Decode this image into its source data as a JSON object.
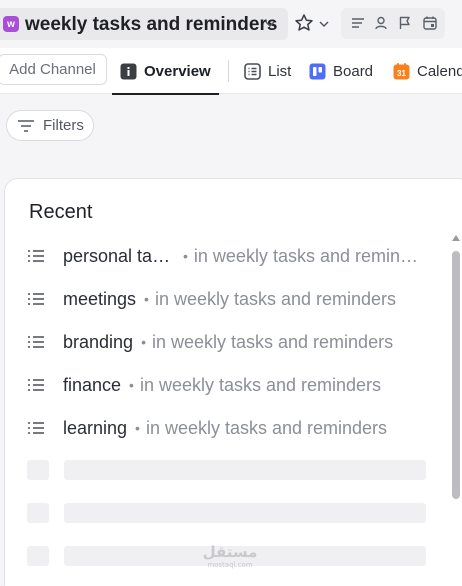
{
  "header": {
    "space_badge": "w",
    "title": "weekly tasks and reminders"
  },
  "tabs": {
    "add_channel": "Add Channel",
    "items": [
      {
        "label": "Overview",
        "icon": "info-icon",
        "active": true
      },
      {
        "label": "List",
        "icon": "list-view-icon"
      },
      {
        "label": "Board",
        "icon": "board-icon"
      },
      {
        "label": "Calendar",
        "icon": "calendar-icon",
        "icon_text": "31"
      }
    ]
  },
  "filters": {
    "label": "Filters"
  },
  "recent": {
    "title": "Recent",
    "separator": "•",
    "rows": [
      {
        "name": "personal tasks",
        "location": "in weekly tasks and reminders"
      },
      {
        "name": "meetings",
        "location": "in weekly tasks and reminders"
      },
      {
        "name": "branding",
        "location": "in weekly tasks and reminders"
      },
      {
        "name": "finance",
        "location": "in weekly tasks and reminders"
      },
      {
        "name": "learning",
        "location": "in weekly tasks and reminders"
      }
    ]
  },
  "watermark": {
    "text": "مستقل",
    "subtext": "mostaql.com"
  },
  "colors": {
    "space_badge": "#a84fd8",
    "board_icon": "#4f6ef7",
    "calendar_icon": "#f5821f"
  }
}
